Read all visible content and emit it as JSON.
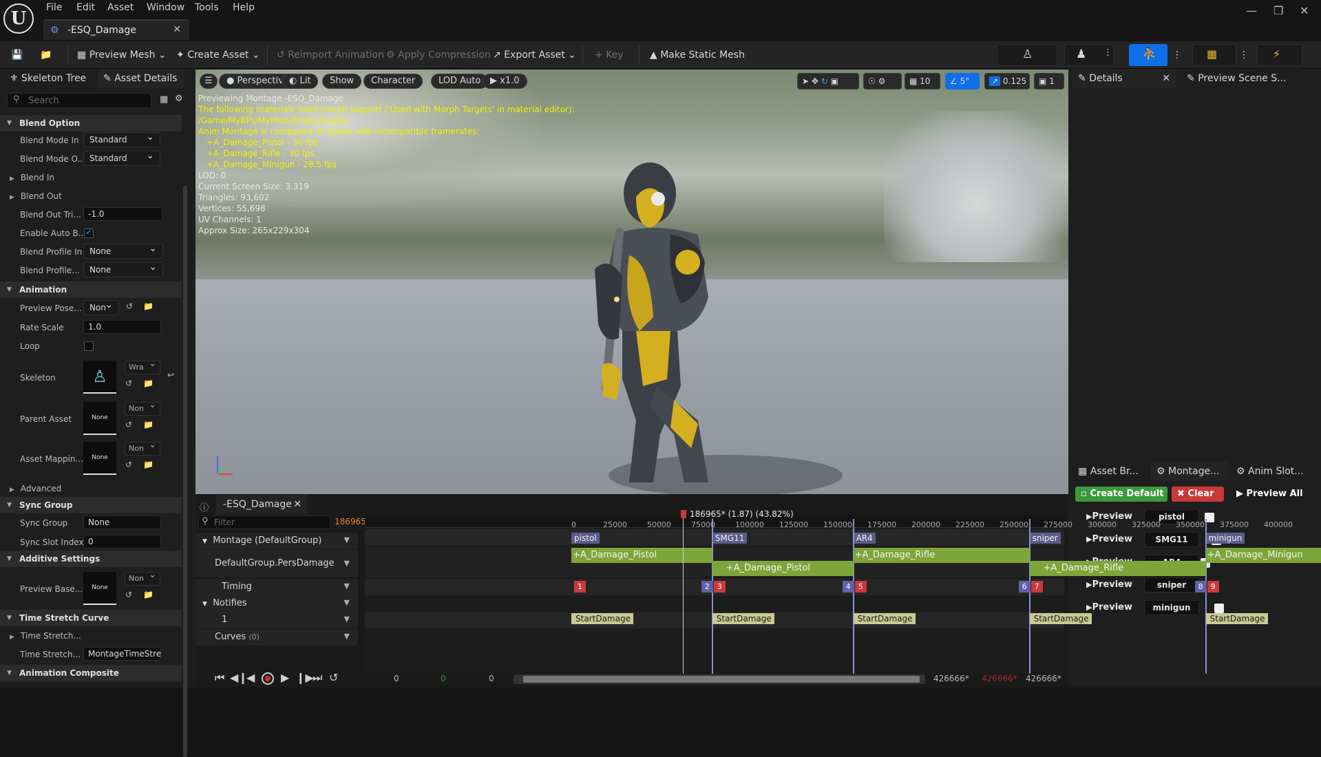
{
  "titlebar": {
    "menu": [
      "File",
      "Edit",
      "Asset",
      "Window",
      "Tools",
      "Help"
    ],
    "doc_tab": "-ESQ_Damage"
  },
  "toolbar": {
    "preview_mesh": "Preview Mesh",
    "create_asset": "Create Asset",
    "reimport": "Reimport Animation",
    "apply_compression": "Apply Compression",
    "export_asset": "Export Asset",
    "key": "Key",
    "make_static_mesh": "Make Static Mesh"
  },
  "left": {
    "tabs": [
      "Skeleton Tree",
      "Asset Details"
    ],
    "search_placeholder": "Search",
    "blend_option": "Blend Option",
    "blend_mode_in": {
      "label": "Blend Mode In",
      "value": "Standard"
    },
    "blend_mode_out": {
      "label": "Blend Mode O...",
      "value": "Standard"
    },
    "blend_in": "Blend In",
    "blend_out": "Blend Out",
    "blend_out_trigger": {
      "label": "Blend Out Tri...",
      "value": "-1.0"
    },
    "enable_auto": "Enable Auto B...",
    "blend_profile_in": {
      "label": "Blend Profile In",
      "value": "None"
    },
    "blend_profile_out": {
      "label": "Blend Profile...",
      "value": "None"
    },
    "animation": "Animation",
    "preview_pose": {
      "label": "Preview Pose...",
      "value": "Non"
    },
    "rate_scale": {
      "label": "Rate Scale",
      "value": "1.0"
    },
    "loop": "Loop",
    "skeleton": {
      "label": "Skeleton",
      "value": "Wra"
    },
    "parent_asset": {
      "label": "Parent Asset",
      "thumb": "None",
      "value": "Non"
    },
    "asset_mapping": {
      "label": "Asset Mappin...",
      "thumb": "None",
      "value": "Non"
    },
    "advanced": "Advanced",
    "sync_group": "Sync Group",
    "sync_group_row": {
      "label": "Sync Group",
      "value": "None"
    },
    "sync_slot": {
      "label": "Sync Slot Index",
      "value": "0"
    },
    "additive": "Additive Settings",
    "preview_base": {
      "label": "Preview Base...",
      "thumb": "None",
      "value": "Non"
    },
    "time_stretch": "Time Stretch Curve",
    "time_stretch1": "Time Stretch...",
    "time_stretch2": {
      "label": "Time Stretch...",
      "value": "MontageTimeStre"
    },
    "anim_composite": "Animation Composite"
  },
  "viewport": {
    "buttons": [
      "Perspective",
      "Lit",
      "Show",
      "Character",
      "LOD Auto",
      "x1.0"
    ],
    "grid": "10",
    "angle": "5°",
    "scale": "0.125",
    "cam": "1",
    "overlay_white1": "Previewing Montage -ESQ_Damage",
    "overlay_yellow": [
      "The following materials need morph support ('Used with Morph Targets' in material editor):",
      "/Game/MyBPs/MyMats/Empty.Empty",
      "Anim Montage is composed of assets with incompatible framerates:",
      "    +A_Damage_Pistol - 30 fps",
      "    +A_Damage_Rifle - 30 fps",
      "    +A_Damage_Minigun - 28.5 fps"
    ],
    "overlay_white2": [
      "LOD: 0",
      "Current Screen Size: 3.319",
      "Triangles: 93,602",
      "Vertices: 55,698",
      "UV Channels: 1",
      "Approx Size: 265x229x304"
    ]
  },
  "right": {
    "tabs": [
      "Details",
      "Preview Scene S..."
    ],
    "bottom_tabs": [
      "Asset Br...",
      "Montage...",
      "Anim Slot..."
    ],
    "create_default": "Create Default",
    "clear": "Clear",
    "preview_all": "Preview All",
    "preview_label": "Preview",
    "sections": [
      "pistol",
      "SMG11",
      "AR4",
      "sniper",
      "minigun"
    ]
  },
  "montage": {
    "tab": "-ESQ_Damage",
    "filter_placeholder": "Filter",
    "frame": "186965*",
    "playhead_label": "186965* (1.87) (43.82%)",
    "ruler": [
      "0",
      "25000",
      "50000",
      "75000",
      "100000",
      "125000",
      "150000",
      "175000",
      "200000",
      "225000",
      "250000",
      "275000",
      "300000",
      "325000",
      "350000",
      "375000",
      "400000"
    ],
    "tracks": {
      "montage": "Montage (DefaultGroup)",
      "slot": "DefaultGroup.PersDamage",
      "timing": "Timing",
      "notifies": "Notifies",
      "notify_track": "1",
      "curves": "Curves",
      "curves_count": "(0)"
    },
    "sections": [
      "pistol",
      "SMG11",
      "AR4",
      "sniper",
      "minigun"
    ],
    "segments_top": [
      "+A_Damage_Pistol",
      "+A_Damage_Rifle",
      "+A_Damage_Minigun"
    ],
    "segments_bottom": [
      "+A_Damage_Pistol",
      "+A_Damage_Rifle"
    ],
    "timing": [
      "1",
      "2",
      "3",
      "4",
      "5",
      "6",
      "7",
      "8",
      "9"
    ],
    "notify": "StartDamage",
    "play_start": "0",
    "play_mid": "0",
    "play_end": "0",
    "range_end": "426666*",
    "range_red": "426666*",
    "range_total": "426666*"
  },
  "colors": {
    "accent": "#0f6fe8",
    "section": "#5c5c8a",
    "segment": "#7da63a",
    "notify": "#c9c995",
    "timing_red": "#c83a3a",
    "timing_blue": "#6060a8"
  }
}
